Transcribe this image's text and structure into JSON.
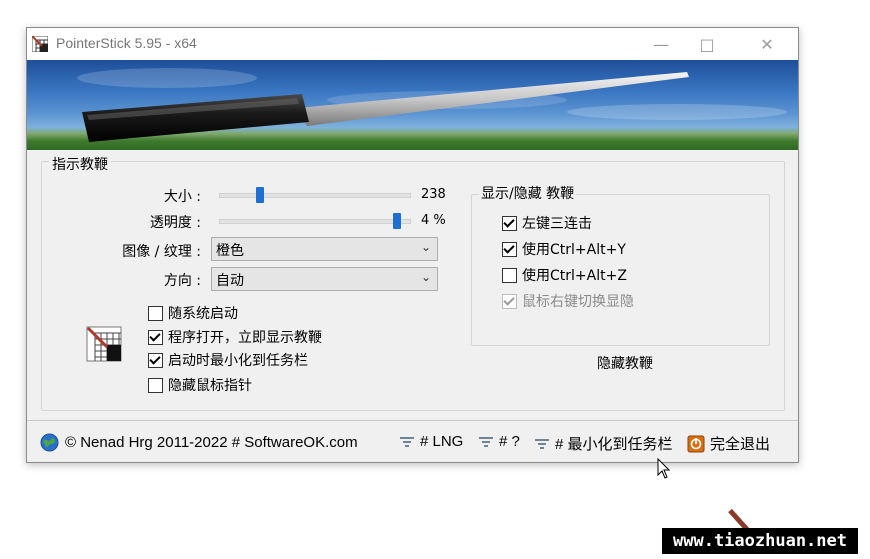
{
  "window": {
    "title": "PointerStick 5.95 - x64",
    "controls": {
      "minimize": "—",
      "maximize": "□",
      "close": "✕"
    }
  },
  "pointer_group": {
    "title": "指示教鞭",
    "size": {
      "label": "大小 :",
      "value": "238",
      "level": 0.29
    },
    "opacity": {
      "label": "透明度 :",
      "value": "4 %",
      "level": 0.97
    },
    "texture": {
      "label": "图像 / 纹理 :",
      "selected": "橙色"
    },
    "direction": {
      "label": "方向 :",
      "selected": "自动"
    },
    "checkboxes": [
      {
        "label": "随系统启动",
        "checked": false
      },
      {
        "label": "程序打开，立即显示教鞭",
        "checked": true
      },
      {
        "label": "启动时最小化到任务栏",
        "checked": true
      },
      {
        "label": "隐藏鼠标指针",
        "checked": false
      }
    ]
  },
  "show_hide_group": {
    "title": "显示/隐藏 教鞭",
    "checkboxes": [
      {
        "label": "左键三连击",
        "checked": true,
        "disabled": false
      },
      {
        "label": "使用Ctrl+Alt+Y",
        "checked": true,
        "disabled": false
      },
      {
        "label": "使用Ctrl+Alt+Z",
        "checked": false,
        "disabled": false
      },
      {
        "label": "鼠标右键切换显隐",
        "checked": true,
        "disabled": true
      }
    ],
    "hide_button": "隐藏教鞭"
  },
  "statusbar": {
    "copyright": "© Nenad Hrg 2011-2022 # SoftwareOK.com",
    "lng": "# LNG",
    "help": "# ?",
    "minimize": "# 最小化到任务栏",
    "exit": "完全退出"
  },
  "watermark": "www.tiaozhuan.net",
  "icons": {
    "app": "pointer-grid-icon",
    "globe": "globe-icon",
    "menu": "menu-icon",
    "exit": "exit-icon",
    "cursor": "mouse-cursor-icon"
  },
  "colors": {
    "accent": "#1f6fd1",
    "window_bg": "#f0f0f0",
    "exit_icon": "#d9700f"
  }
}
